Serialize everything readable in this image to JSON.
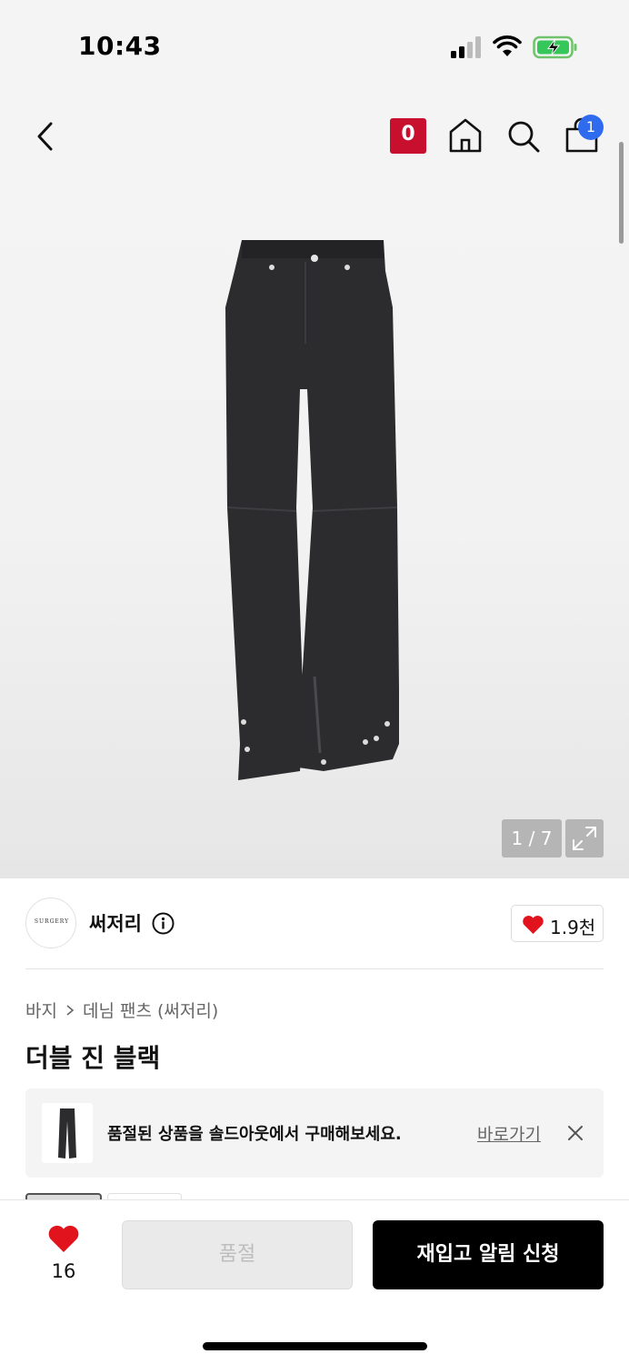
{
  "status_bar": {
    "time": "10:43"
  },
  "header": {
    "badge_letter": "0",
    "cart_count": "1"
  },
  "gallery": {
    "counter": "1 / 7"
  },
  "brand": {
    "logo_text": "SURGERY",
    "name": "써저리",
    "likes": "1.9천"
  },
  "breadcrumb": {
    "category": "바지",
    "subcategory": "데님 팬츠 (써저리)"
  },
  "product": {
    "title": "더블 진 블랙"
  },
  "soldout_banner": {
    "message": "품절된 상품을 솔드아웃에서 구매해보세요.",
    "link": "바로가기"
  },
  "bottom_bar": {
    "wish_count": "16",
    "soldout_label": "품절",
    "restock_label": "재입고 알림 신청"
  },
  "colors": {
    "accent_red": "#c8102e",
    "heart_red": "#e1141e",
    "cart_badge": "#2f6bef"
  }
}
